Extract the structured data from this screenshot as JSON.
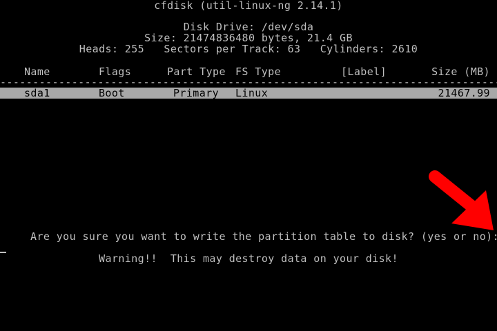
{
  "header": {
    "title": "cfdisk (util-linux-ng 2.14.1)",
    "disk_drive": "Disk Drive: /dev/sda",
    "size": "Size: 21474836480 bytes, 21.4 GB",
    "geometry": "Heads: 255   Sectors per Track: 63   Cylinders: 2610"
  },
  "table": {
    "columns": {
      "name": "Name",
      "flags": "Flags",
      "part_type": "Part Type",
      "fs_type": "FS Type",
      "label": "[Label]",
      "size": "Size (MB)"
    },
    "separator": "--------------------------------------------------------------------------------",
    "rows": [
      {
        "name": "sda1",
        "flags": "Boot",
        "part_type": "Primary",
        "fs_type": "Linux",
        "label": "",
        "size": "21467.99"
      }
    ]
  },
  "prompt": {
    "question": "Are you sure you want to write the partition table to disk? (yes or no): ye",
    "warning": "Warning!!  This may destroy data on your disk!"
  },
  "colors": {
    "background": "#000000",
    "text": "#bfbfbf",
    "selection": "#a8a8a8",
    "arrow": "#ff0000"
  },
  "annotation": {
    "icon": "red-arrow-icon"
  }
}
